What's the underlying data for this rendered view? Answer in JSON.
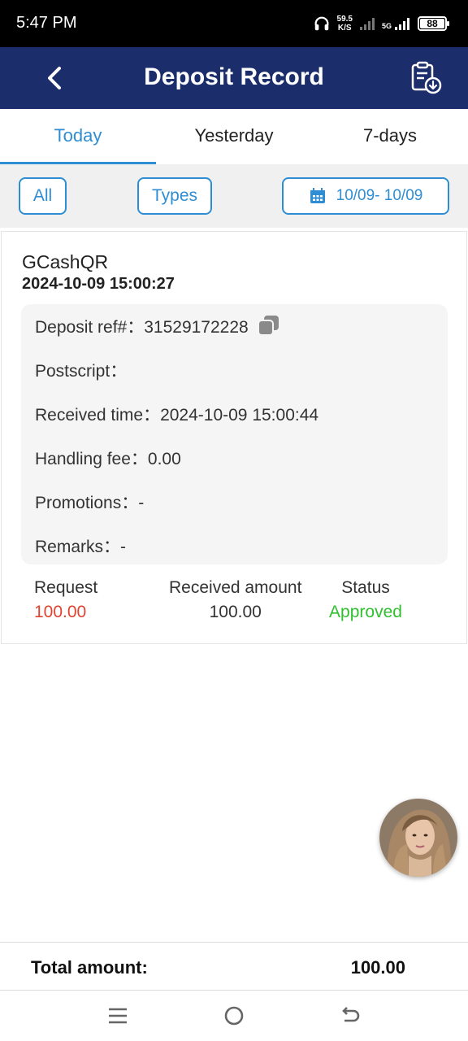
{
  "status_bar": {
    "time": "5:47 PM",
    "net_speed_value": "59.5",
    "net_speed_unit": "K/S",
    "network": "5G",
    "battery": "88"
  },
  "header": {
    "title": "Deposit Record",
    "back_icon": "chevron-left-icon",
    "export_icon": "clipboard-download-icon",
    "background": "#1b2e6b"
  },
  "tabs": [
    {
      "label": "Today",
      "active": true
    },
    {
      "label": "Yesterday",
      "active": false
    },
    {
      "label": "7-days",
      "active": false
    }
  ],
  "filters": {
    "all_label": "All",
    "types_label": "Types",
    "date_range": "10/09- 10/09",
    "date_icon": "calendar-icon",
    "accent": "#2f8ed3"
  },
  "record": {
    "method": "GCashQR",
    "datetime": "2024-10-09 15:00:27",
    "details": {
      "ref_label": "Deposit ref#：",
      "ref_value": "31529172228",
      "postscript_label": "Postscript：",
      "postscript_value": "",
      "received_time_label": "Received time：",
      "received_time_value": "2024-10-09 15:00:44",
      "handling_fee_label": "Handling fee：",
      "handling_fee_value": "0.00",
      "promotions_label": "Promotions：",
      "promotions_value": "-",
      "remarks_label": "Remarks：",
      "remarks_value": "-"
    },
    "summary": {
      "request_label": "Request",
      "request_value": "100.00",
      "request_color": "#e0432f",
      "received_label": "Received amount",
      "received_value": "100.00",
      "status_label": "Status",
      "status_value": "Approved",
      "status_color": "#2fbf2f"
    }
  },
  "total": {
    "label": "Total amount:",
    "value": "100.00"
  },
  "nav": {
    "menu_icon": "menu-icon",
    "home_icon": "home-circle-icon",
    "back_icon": "back-arrow-icon"
  }
}
